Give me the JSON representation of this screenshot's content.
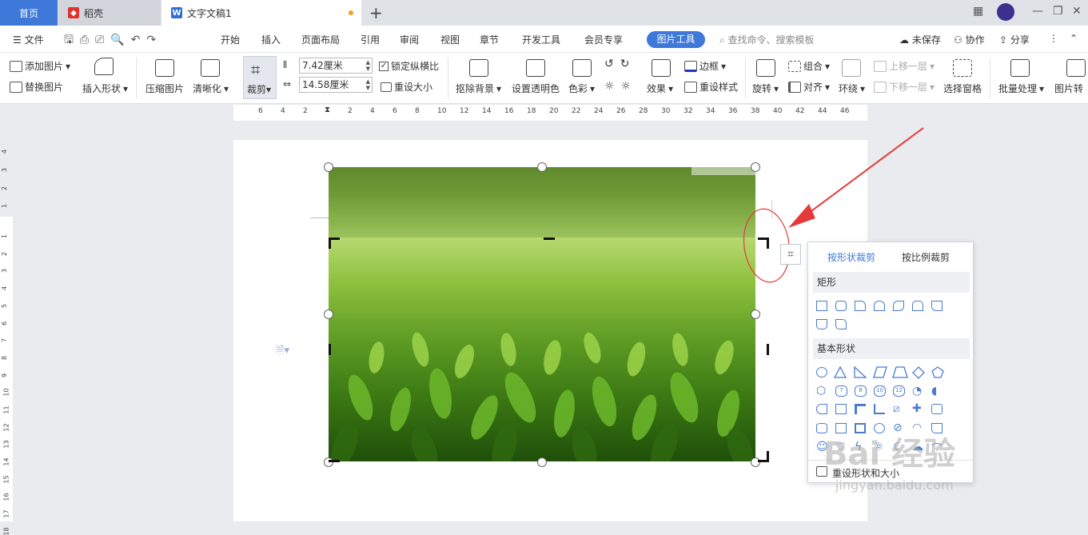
{
  "tabs": {
    "home": "首页",
    "daoke": "稻壳",
    "doc": "文字文稿1"
  },
  "menu": {
    "file": "文件",
    "items": [
      "开始",
      "插入",
      "页面布局",
      "引用",
      "审阅",
      "视图",
      "章节",
      "开发工具",
      "会员专享"
    ],
    "active": "图片工具",
    "search_placeholder": "查找命令、搜索模板",
    "unsaved": "未保存",
    "collab": "协作",
    "share": "分享"
  },
  "ribbon": {
    "add_picture": "添加图片",
    "replace_picture": "替换图片",
    "insert_shape": "插入形状",
    "compress": "压缩图片",
    "sharpen": "清晰化",
    "crop": "裁剪",
    "height": "7.42厘米",
    "width": "14.58厘米",
    "lock_ratio": "锁定纵横比",
    "reset_size": "重设大小",
    "remove_bg": "抠除背景",
    "set_transparent": "设置透明色",
    "color": "色彩",
    "effects": "效果",
    "border": "边框",
    "reset_style": "重设样式",
    "rotate": "旋转",
    "group": "组合",
    "align": "对齐",
    "wrap": "环绕",
    "bring_forward": "上移一层",
    "send_backward": "下移一层",
    "selection_pane": "选择窗格",
    "batch": "批量处理",
    "picture_convert": "图片转"
  },
  "ruler": {
    "h_ticks": [
      "6",
      "4",
      "2",
      "2",
      "4",
      "6",
      "8",
      "10",
      "12",
      "14",
      "16",
      "18",
      "20",
      "22",
      "24",
      "26",
      "28",
      "30",
      "32",
      "34",
      "36",
      "38",
      "40",
      "42",
      "44",
      "46"
    ],
    "v_ticks": [
      "4",
      "3",
      "2",
      "1",
      "1",
      "2",
      "3",
      "4",
      "5",
      "6",
      "7",
      "8",
      "9",
      "10",
      "11",
      "12",
      "13",
      "14",
      "15",
      "16",
      "17",
      "18"
    ]
  },
  "panel": {
    "tab_shape": "按形状裁剪",
    "tab_ratio": "按比例裁剪",
    "section_rect": "矩形",
    "section_basic": "基本形状",
    "reset": "重设形状和大小",
    "basic_numbers": [
      "7",
      "8",
      "10",
      "12"
    ]
  },
  "watermark": {
    "text": "Bai 经验",
    "url": "jingyan.baidu.com"
  },
  "colors": {
    "accent": "#3e78d8",
    "annotation": "#e53a3a"
  }
}
